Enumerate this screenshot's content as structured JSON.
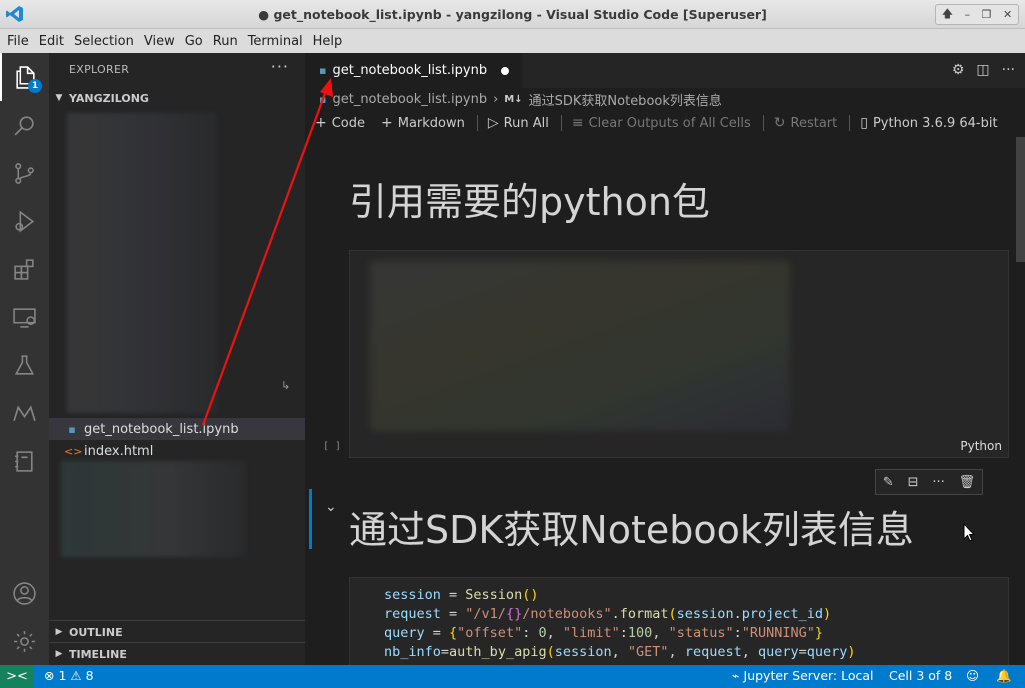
{
  "window": {
    "title": "● get_notebook_list.ipynb - yangzilong - Visual Studio Code [Superuser]",
    "buttons": [
      "🡅",
      "–",
      "❐",
      "✕"
    ]
  },
  "menu": [
    "File",
    "Edit",
    "Selection",
    "View",
    "Go",
    "Run",
    "Terminal",
    "Help"
  ],
  "activity_bar": {
    "explorer_badge": "1",
    "icons": [
      "files-icon",
      "search-icon",
      "source-control-icon",
      "run-debug-icon",
      "extensions-icon",
      "remote-explorer-icon",
      "testing-icon",
      "modelarts-icon",
      "notebook-icon",
      "account-icon",
      "settings-gear-icon"
    ]
  },
  "sidebar": {
    "title": "EXPLORER",
    "more": "···",
    "folder": "YANGZILONG",
    "files": [
      {
        "name": "get_notebook_list.ipynb",
        "icon": "▪"
      },
      {
        "name": "index.html",
        "icon": "<>"
      }
    ],
    "outline": "OUTLINE",
    "timeline": "TIMELINE"
  },
  "editor": {
    "tab_label": "get_notebook_list.ipynb",
    "breadcrumb": [
      "get_notebook_list.ipynb",
      "›",
      "M↓",
      "通过SDK获取Notebook列表信息"
    ],
    "toolbar": {
      "code": "Code",
      "markdown": "Markdown",
      "run_all": "Run All",
      "clear": "Clear Outputs of All Cells",
      "restart": "Restart",
      "kernel": "Python 3.6.9 64-bit"
    },
    "cells": {
      "md1": "引用需要的python包",
      "code1_exec": "[ ]",
      "code1_lang": "Python",
      "md2": "通过SDK获取Notebook列表信息",
      "code2_lines": [
        "session = Session()",
        "request = \"/v1/{}/notebooks\".format(session.project_id)",
        "query = {\"offset\": 0, \"limit\":100, \"status\":\"RUNNING\"}",
        "nb_info=auth_by_apig(session, \"GET\", request, query=query)"
      ]
    }
  },
  "statusbar": {
    "remote": "><",
    "errors": "1",
    "warnings": "8",
    "jupyter": "Jupyter Server: Local",
    "cell_pos": "Cell 3 of 8"
  }
}
